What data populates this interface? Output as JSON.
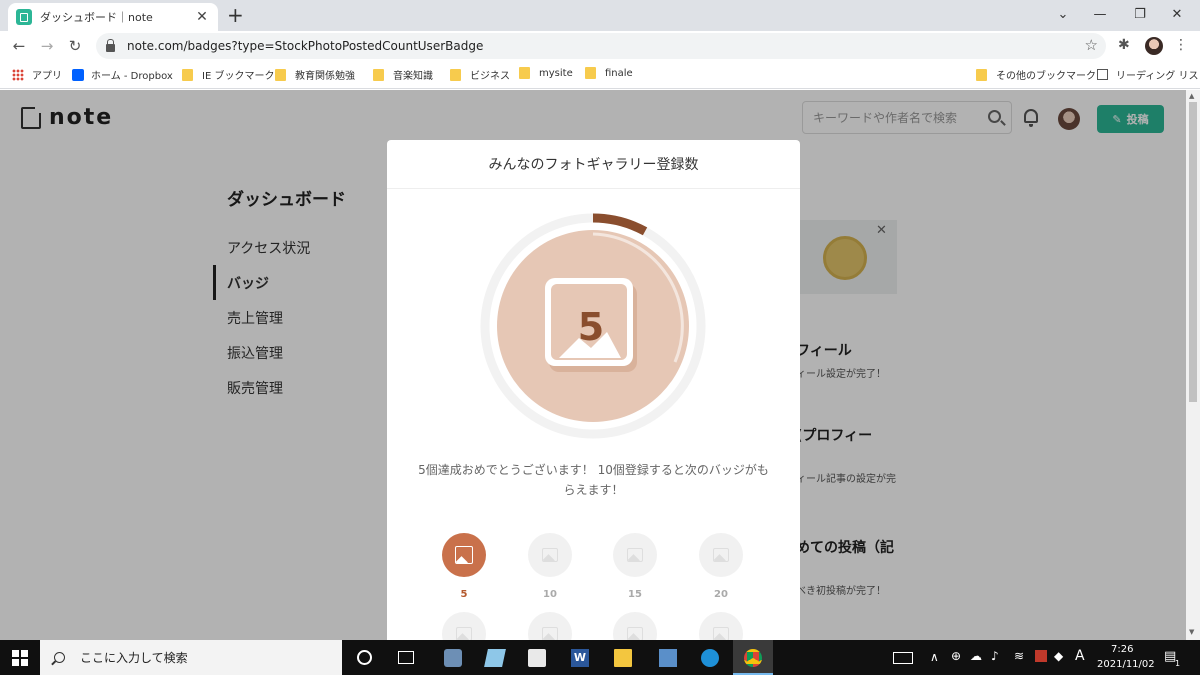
{
  "browser": {
    "tab_title": "ダッシュボード｜note",
    "url": "note.com/badges?type=StockPhotoPostedCountUserBadge",
    "bookmarks": [
      {
        "label": "アプリ",
        "kind": "apps"
      },
      {
        "label": "ホーム - Dropbox",
        "kind": "dropbox"
      },
      {
        "label": "IE ブックマーク",
        "kind": "folder"
      },
      {
        "label": "教育関係勉強",
        "kind": "folder"
      },
      {
        "label": "音楽知識",
        "kind": "folder"
      },
      {
        "label": "ビジネス",
        "kind": "folder"
      },
      {
        "label": "mysite",
        "kind": "folder"
      },
      {
        "label": "finale",
        "kind": "folder"
      }
    ],
    "other_bookmarks": "その他のブックマーク",
    "reading_list": "リーディング リスト"
  },
  "header": {
    "logo": "note",
    "search_placeholder": "キーワードや作者名で検索",
    "post_button": "投稿"
  },
  "sidebar": {
    "title": "ダッシュボード",
    "items": [
      {
        "label": "アクセス状況",
        "active": false
      },
      {
        "label": "バッジ",
        "active": true
      },
      {
        "label": "売上管理",
        "active": false
      },
      {
        "label": "振込管理",
        "active": false
      },
      {
        "label": "販売管理",
        "active": false
      }
    ]
  },
  "right_panel": {
    "items": [
      {
        "heading": "フィール",
        "sub": "ィール設定が完了！"
      },
      {
        "heading": "(プロフィー",
        "sub": "ィール記事の設定が完"
      },
      {
        "heading": "めての投稿（記",
        "sub": "べき初投稿が完了！"
      }
    ]
  },
  "modal": {
    "title": "みんなのフォトギャラリー登録数",
    "badge_number": "5",
    "progress": 0.08,
    "message": "5個達成おめでとうございます！ 10個登録すると次のバッジがもらえます！",
    "milestones": [
      {
        "label": "5",
        "achieved": true
      },
      {
        "label": "10",
        "achieved": false
      },
      {
        "label": "15",
        "achieved": false
      },
      {
        "label": "20",
        "achieved": false
      }
    ]
  },
  "taskbar": {
    "search_placeholder": "ここに入力して検索",
    "ime": "A",
    "time": "7:26",
    "date": "2021/11/02",
    "notification_count": "1"
  },
  "colors": {
    "accent": "#2cb696",
    "badge_brown": "#b4592e",
    "badge_fill": "#e6c7b5"
  }
}
